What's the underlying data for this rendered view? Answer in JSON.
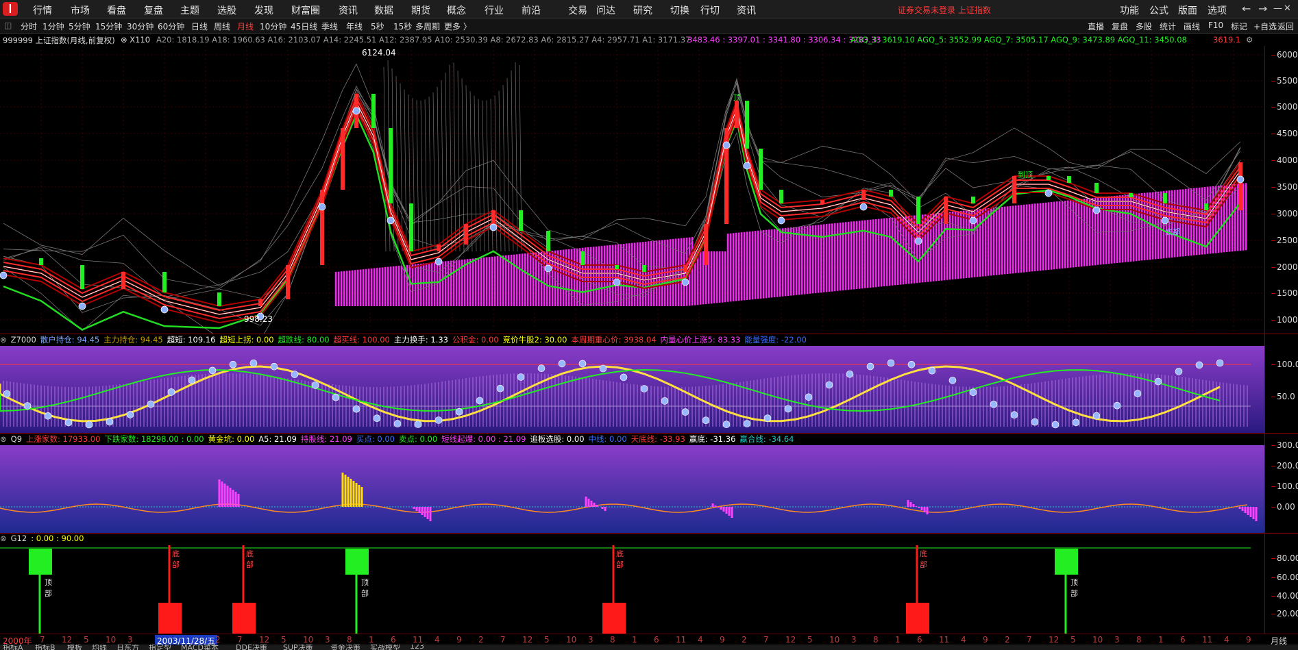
{
  "app": {
    "logo_text": "❙",
    "menu": [
      "行情",
      "市场",
      "看盘",
      "复盘",
      "主题",
      "选股",
      "发现",
      "财富圈",
      "资讯",
      "数据",
      "期货",
      "概念",
      "行业",
      "前沿",
      "交易",
      "问达",
      "研究",
      "切换",
      "行切",
      "资讯"
    ],
    "warning": "证券交易未登录  上证指数",
    "right_menu": [
      "功能",
      "公式",
      "版面",
      "选项"
    ],
    "nav": {
      "back": "←",
      "forward": "→",
      "min": "—",
      "max": "☐",
      "close": "✕"
    }
  },
  "periods": {
    "items": [
      "分时",
      "1分钟",
      "5分钟",
      "15分钟",
      "30分钟",
      "60分钟",
      "日线",
      "周线",
      "月线",
      "10分钟",
      "45日线",
      "季线",
      "年线",
      "5秒",
      "15秒",
      "多周期",
      "更多 〉"
    ],
    "active": "月线",
    "right_tools": [
      "直播",
      "复盘",
      "多股",
      "统计",
      "画线",
      "F10",
      "标记",
      "+自选",
      "返回"
    ]
  },
  "info": {
    "title": "999999 上证指数(月线,前复权)",
    "x110": "⊗ X110",
    "ma_vals": "A20: 1818.19  A18: 1960.63  A16: 2103.07  A14: 2245.51  A12: 2387.95  A10: 2530.39  A8: 2672.83  A6: 2815.27  A4: 2957.71  A1: 3171.37",
    "magenta_vals": "3483.46 : 3397.01 : 3341.80 : 3306.34 : 3283.33",
    "agq_vals": "AGQ_3: 3619.10  AGQ_5: 3552.99  AGQ_7: 3505.17  AGQ_9: 3473.89  AGQ_11: 3450.08",
    "last": "3619.1",
    "colors": {
      "gray": "#9a9a9a",
      "magenta": "#ff40ff",
      "green": "#22ee22",
      "red": "#ff3a3a"
    }
  },
  "main_chart": {
    "annotations": {
      "high": "6124.04",
      "low": "998.23",
      "top1": "顶",
      "top2": "到顶",
      "bottom": "底部"
    },
    "y_ticks": [
      "6000.0",
      "5500.0",
      "5000.0",
      "4500.0",
      "4000.0",
      "3500.0",
      "3000.0",
      "2500.0",
      "2000.0",
      "1500.0",
      "1000.0"
    ]
  },
  "z7000": {
    "name": "Z7000",
    "fields": [
      {
        "t": "散户持仓: 94.45",
        "c": "#7aa7ff"
      },
      {
        "t": "主力持仓: 94.45",
        "c": "#c8a000"
      },
      {
        "t": "超短: 109.16",
        "c": "#ffffff"
      },
      {
        "t": "超短上拐: 0.00",
        "c": "#ffff00"
      },
      {
        "t": "超跌线: 80.00",
        "c": "#22ee22"
      },
      {
        "t": "超买线: 100.00",
        "c": "#ff3a3a"
      },
      {
        "t": "主力换手: 1.33",
        "c": "#ffffff"
      },
      {
        "t": "公积金: 0.00",
        "c": "#ff3a3a"
      },
      {
        "t": "竞价牛股2: 30.00",
        "c": "#ffff00"
      },
      {
        "t": "本周期重心价: 3938.04",
        "c": "#ff3a3a"
      },
      {
        "t": "内量心价上涨5: 83.33",
        "c": "#ff40ff"
      },
      {
        "t": "能量强度: -22.00",
        "c": "#3a6bff"
      }
    ],
    "y_ticks": [
      "100.0",
      "50.0"
    ]
  },
  "q9": {
    "name": "Q9",
    "fields": [
      {
        "t": "上涨家数: 17933.00",
        "c": "#ff3a3a"
      },
      {
        "t": "下跌家数: 18298.00 : 0.00",
        "c": "#22ee22"
      },
      {
        "t": "黄金坑: 0.00",
        "c": "#ffff00"
      },
      {
        "t": "A5: 21.09",
        "c": "#ffffff"
      },
      {
        "t": "持股线: 21.09",
        "c": "#ff40ff"
      },
      {
        "t": "买点: 0.00",
        "c": "#3a6bff"
      },
      {
        "t": "卖点: 0.00",
        "c": "#22ee22"
      },
      {
        "t": "短线起爆: 0.00 : 21.09",
        "c": "#ff40ff"
      },
      {
        "t": "追板选股: 0.00",
        "c": "#ffffff"
      },
      {
        "t": "中线: 0.00",
        "c": "#3a6bff"
      },
      {
        "t": "天底线: -33.93",
        "c": "#ff3a3a"
      },
      {
        "t": "赢底: -31.36",
        "c": "#ffffff"
      },
      {
        "t": "赢合线: -34.64",
        "c": "#22cccc"
      }
    ],
    "y_ticks": [
      "300.0",
      "200.0",
      "100.0",
      "0.00"
    ]
  },
  "g12": {
    "name": "G12",
    "fields": [
      {
        "t": ": 0.00 : 90.00",
        "c": "#ffff00"
      }
    ],
    "y_ticks": [
      "80.00",
      "60.00",
      "40.00",
      "20.00"
    ],
    "signals": [
      {
        "type": "top",
        "label": "顶部"
      },
      {
        "type": "bottom",
        "label": "底部"
      },
      {
        "type": "bottom",
        "label": "底部"
      },
      {
        "type": "top",
        "label": "顶部"
      },
      {
        "type": "bottom",
        "label": "底部"
      },
      {
        "type": "bottom",
        "label": "底部"
      },
      {
        "type": "top",
        "label": "顶部"
      }
    ]
  },
  "x_axis": {
    "start": "2000年",
    "cursor": "2003/11/28/五",
    "ticks": [
      "7",
      "12",
      "5",
      "10",
      "3",
      "8",
      "4",
      "9",
      "2",
      "7",
      "12",
      "5",
      "10",
      "3",
      "8",
      "1",
      "6",
      "11",
      "4",
      "9",
      "2",
      "7",
      "12",
      "5",
      "10",
      "3",
      "8",
      "1",
      "6",
      "11",
      "4",
      "9",
      "2",
      "7",
      "12",
      "5",
      "10",
      "3",
      "8",
      "1",
      "6",
      "11",
      "4",
      "9",
      "2",
      "7",
      "12",
      "5",
      "10",
      "3",
      "8",
      "1",
      "6",
      "11",
      "4",
      "9"
    ],
    "right_label": "月线"
  },
  "tabs": [
    "指标A",
    "指标B",
    "模板",
    "均线",
    "日东方",
    "指定型",
    "MACD菜本",
    "DDE决策",
    "SUP决策",
    "资金决策",
    "实战模型",
    "123"
  ]
}
